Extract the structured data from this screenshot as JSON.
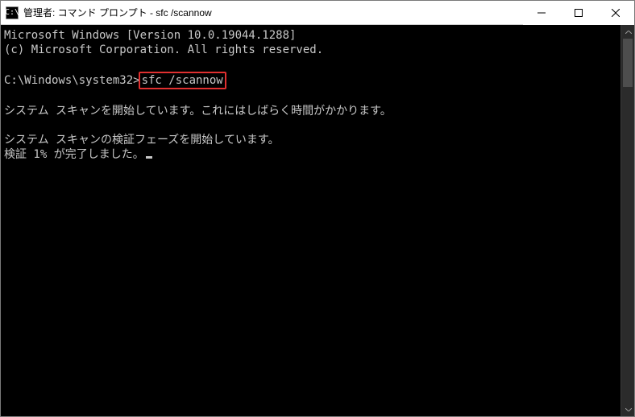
{
  "window": {
    "icon_text": "C:\\",
    "title": "管理者: コマンド プロンプト - sfc  /scannow"
  },
  "terminal": {
    "line_version": "Microsoft Windows [Version 10.0.19044.1288]",
    "line_copyright": "(c) Microsoft Corporation. All rights reserved.",
    "blank1": "",
    "prompt_prefix": "C:\\Windows\\system32>",
    "prompt_command": "sfc /scannow",
    "blank2": "",
    "scan_start": "システム スキャンを開始しています。これにはしばらく時間がかかります。",
    "blank3": "",
    "verify_start": "システム スキャンの検証フェーズを開始しています。",
    "verify_progress": "検証 1% が完了しました。"
  }
}
